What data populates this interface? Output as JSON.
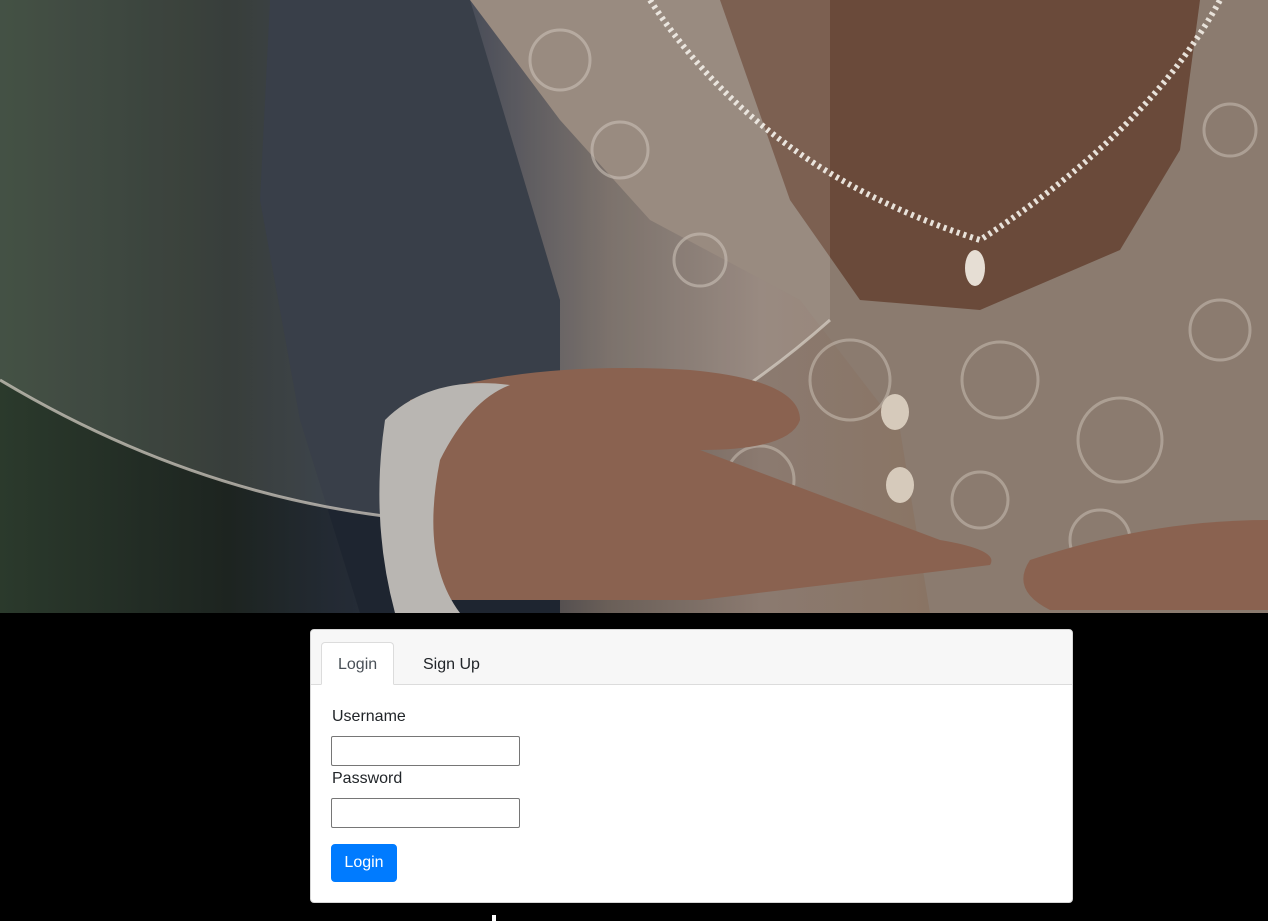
{
  "tabs": [
    {
      "label": "Login",
      "active": true
    },
    {
      "label": "Sign Up",
      "active": false
    }
  ],
  "form": {
    "username_label": "Username",
    "username_value": "",
    "password_label": "Password",
    "password_value": "",
    "submit_label": "Login"
  },
  "colors": {
    "page_background": "#000000",
    "primary": "#007bff",
    "card_header": "#f7f7f7"
  }
}
